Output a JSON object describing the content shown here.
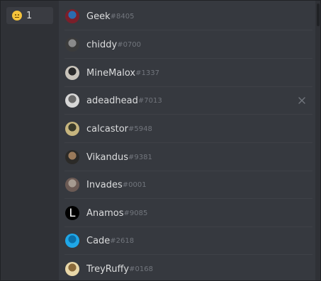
{
  "reactions": [
    {
      "emoji": "slightly-smiling-face",
      "count": "1"
    }
  ],
  "users": [
    {
      "name": "Geek",
      "tag": "#8405",
      "avatar_color": "#7a1f2a",
      "avatar_accent": "#2b6cb0"
    },
    {
      "name": "chiddy",
      "tag": "#0700",
      "avatar_color": "#3b3b3b",
      "avatar_accent": "#8a8a8a"
    },
    {
      "name": "MineMalox",
      "tag": "#1337",
      "avatar_color": "#c9c4bb",
      "avatar_accent": "#2a2a2a"
    },
    {
      "name": "adeadhead",
      "tag": "#7013",
      "avatar_color": "#d7d7d7",
      "avatar_accent": "#6a6a6a",
      "show_remove": true
    },
    {
      "name": "calcastor",
      "tag": "#5948",
      "avatar_color": "#c6b57e",
      "avatar_accent": "#3a3a2a"
    },
    {
      "name": "Vikandus",
      "tag": "#9381",
      "avatar_color": "#2b2a28",
      "avatar_accent": "#9a7a5a"
    },
    {
      "name": "Invades",
      "tag": "#0001",
      "avatar_color": "#6b5a54",
      "avatar_accent": "#a59a90"
    },
    {
      "name": "Anamos",
      "tag": "#9085",
      "avatar_color": "#000000",
      "avatar_accent": "#ffffff",
      "letter": "L"
    },
    {
      "name": "Cade",
      "tag": "#2618",
      "avatar_color": "#1fa7e8",
      "avatar_accent": "#0b6fa8"
    },
    {
      "name": "TreyRuffy",
      "tag": "#0168",
      "avatar_color": "#e8d7a8",
      "avatar_accent": "#8a6a3a"
    }
  ],
  "colors": {
    "sidebar_bg": "#2f3136",
    "list_bg": "#36393f",
    "text": "#dcddde",
    "muted": "#72767d"
  }
}
